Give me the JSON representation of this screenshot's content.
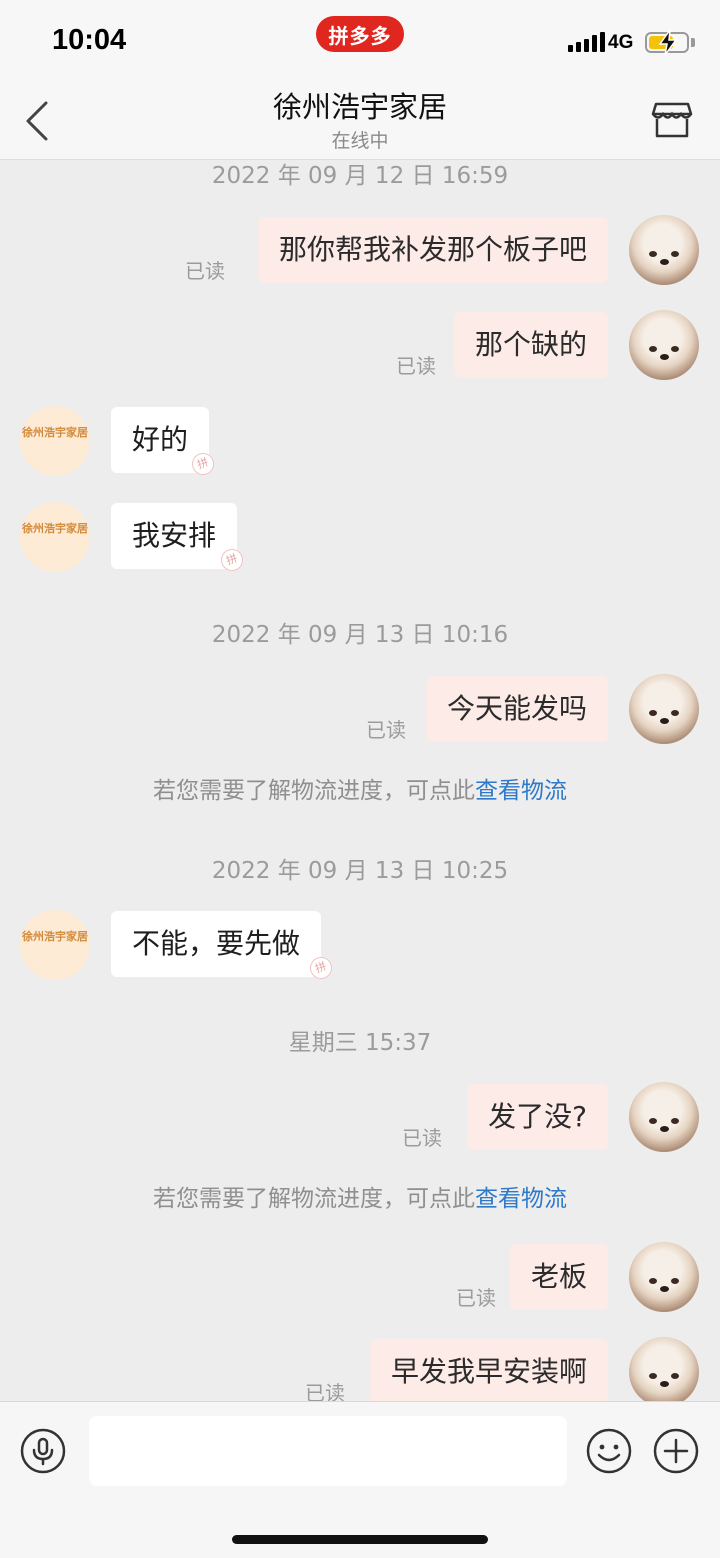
{
  "status_bar": {
    "time": "10:04",
    "app_badge": "拼多多",
    "network": "4G"
  },
  "nav": {
    "title": "徐州浩宇家居",
    "subtitle": "在线中",
    "back_icon": "chevron-left-icon",
    "store_icon": "store-icon"
  },
  "shop_avatar_text": "徐州浩宇家居",
  "stamp_text": "拼",
  "timestamps": [
    "2022 年 09 月 12 日 16:59",
    "2022 年 09 月 13 日 10:16",
    "2022 年 09 月 13 日 10:25",
    "星期三 15:37"
  ],
  "messages": [
    {
      "from": "me",
      "text": "那你帮我补发那个板子吧",
      "read": "已读"
    },
    {
      "from": "me",
      "text": "那个缺的",
      "read": "已读"
    },
    {
      "from": "shop",
      "text": "好的"
    },
    {
      "from": "shop",
      "text": "我安排"
    },
    {
      "from": "me",
      "text": "今天能发吗",
      "read": "已读"
    },
    {
      "from": "shop",
      "text": "不能，要先做"
    },
    {
      "from": "me",
      "text": "发了没?",
      "read": "已读"
    },
    {
      "from": "me",
      "text": "老板",
      "read": "已读"
    },
    {
      "from": "me",
      "text": "早发我早安装啊",
      "read": "已读"
    }
  ],
  "logistics_hint": {
    "text": "若您需要了解物流进度，可点此",
    "link": "查看物流"
  },
  "composer": {
    "placeholder": "",
    "mic_icon": "microphone-icon",
    "emoji_icon": "emoji-icon",
    "plus_icon": "plus-icon"
  }
}
